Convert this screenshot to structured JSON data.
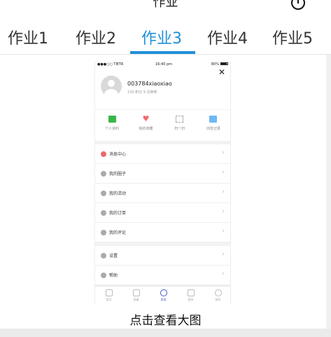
{
  "header": {
    "title": "作业"
  },
  "tabs": [
    {
      "label": "作业1"
    },
    {
      "label": "作业2"
    },
    {
      "label": "作业3",
      "active": true
    },
    {
      "label": "作业4"
    },
    {
      "label": "作业5"
    }
  ],
  "accent_color": "#1f8fd9",
  "phone": {
    "status": {
      "carrier": "●●●○○ TIETA",
      "time": "16:40 pm",
      "battery": "80%"
    },
    "profile": {
      "username": "003784xiaoxiao",
      "points": "130 积分 9 兑换券"
    },
    "quick_actions": [
      {
        "icon": "person-card-icon",
        "label": "个人资料"
      },
      {
        "icon": "heart-icon",
        "label": "我的收藏"
      },
      {
        "icon": "scan-icon",
        "label": "扫一扫"
      },
      {
        "icon": "calendar-icon",
        "label": "浏览记录"
      }
    ],
    "menu": [
      {
        "icon": "message-icon",
        "label": "消息中心"
      },
      {
        "icon": "chat-icon",
        "label": "我的圈子"
      },
      {
        "icon": "flag-icon",
        "label": "我的活动"
      },
      {
        "icon": "order-icon",
        "label": "我的订单"
      },
      {
        "icon": "comment-icon",
        "label": "我的评论"
      }
    ],
    "menu2": [
      {
        "icon": "gear-icon",
        "label": "设置"
      },
      {
        "icon": "help-icon",
        "label": "帮助"
      }
    ],
    "tabbar": [
      {
        "icon": "home-icon",
        "label": "首页"
      },
      {
        "icon": "star-icon",
        "label": "收藏"
      },
      {
        "icon": "compass-icon",
        "label": "发现",
        "active": true
      },
      {
        "icon": "grid-icon",
        "label": "服务"
      },
      {
        "icon": "user-icon",
        "label": "我的"
      }
    ]
  },
  "caption": "点击查看大图"
}
